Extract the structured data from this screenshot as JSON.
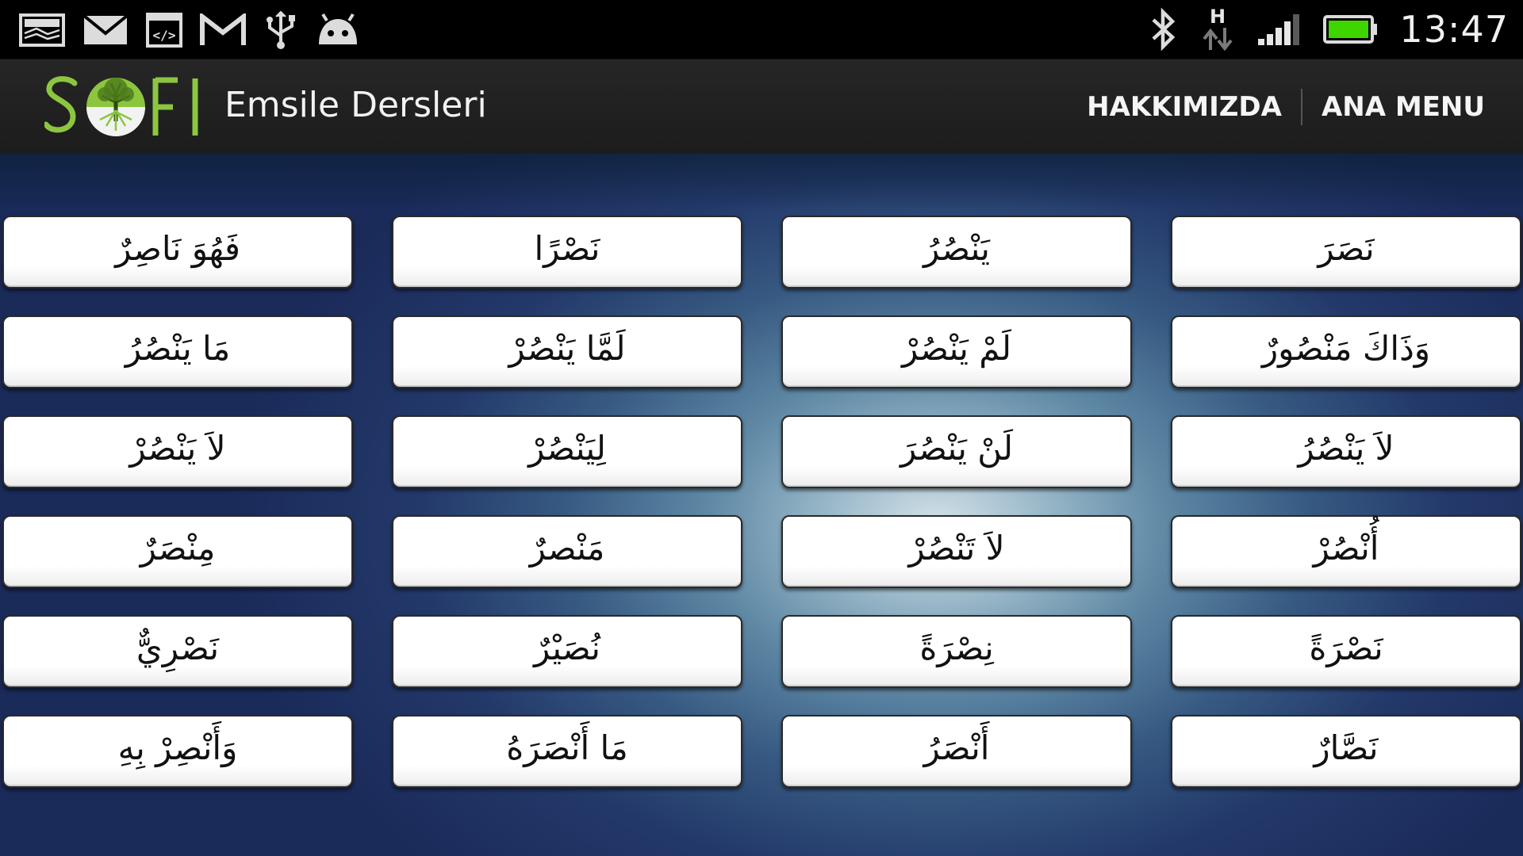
{
  "status_bar": {
    "time": "13:47",
    "left_icons": [
      "gallery-icon",
      "email-icon",
      "developer-code-icon",
      "gmail-icon",
      "usb-icon",
      "android-debug-icon"
    ],
    "right_icons": [
      "bluetooth-icon",
      "data-hspa-icon",
      "signal-icon",
      "battery-icon"
    ],
    "data_type": "H",
    "battery_color": "#3fd600"
  },
  "action_bar": {
    "logo_text": "S FI",
    "logo_color": "#8cc63f",
    "title": "Emsile Dersleri",
    "actions": [
      {
        "label": "HAKKIMIZDA"
      },
      {
        "label": "ANA MENU"
      }
    ]
  },
  "grid": {
    "rows": [
      [
        "فَهُوَ نَاصِرٌ",
        "نَصْرًا",
        "يَنْصُرُ",
        "نَصَرَ"
      ],
      [
        "مَا يَنْصُرُ",
        "لَمَّا يَنْصُرْ",
        "لَمْ يَنْصُرْ",
        "وَذَاكَ مَنْصُورٌ"
      ],
      [
        "لاَ يَنْصُرْ",
        "لِيَنْصُرْ",
        "لَنْ يَنْصُرَ",
        "لاَ يَنْصُرُ"
      ],
      [
        "مِنْصَرٌ",
        "مَنْصرٌ",
        "لاَ تَنْصُرْ",
        "أُنْصُرْ"
      ],
      [
        "نَصْرِيٌّ",
        "نُصَيْرٌ",
        "نِصْرَةً",
        "نَصْرَةً"
      ],
      [
        "وَأَنْصِرْ بِهِ",
        "مَا أَنْصَرَهُ",
        "أَنْصَرُ",
        "نَصَّارٌ"
      ]
    ]
  }
}
